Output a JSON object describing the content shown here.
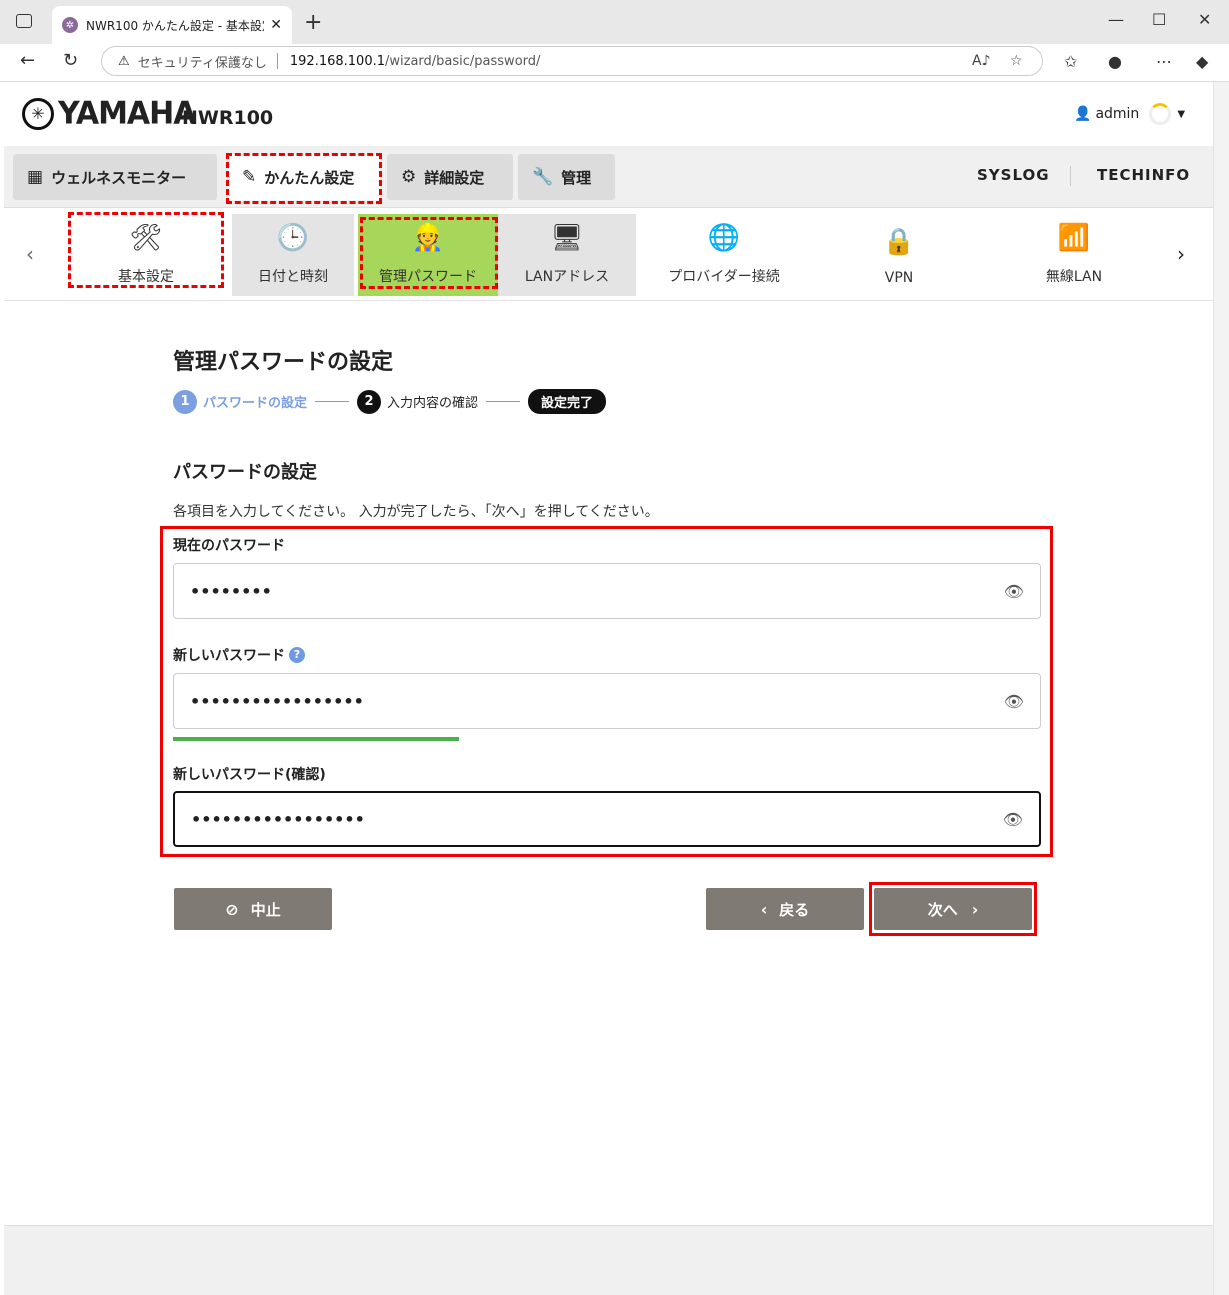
{
  "browser": {
    "tab_title": "NWR100 かんたん設定 - 基本設定 -",
    "security_label": "セキュリティ保護なし",
    "url_host": "192.168.100.1",
    "url_path": "/wizard/basic/password/"
  },
  "header": {
    "brand": "YAMAHA",
    "model": "NWR100",
    "user": "admin"
  },
  "menu": {
    "wellness": "ウェルネスモニター",
    "easy": "かんたん設定",
    "advanced": "詳細設定",
    "admin": "管理",
    "syslog": "SYSLOG",
    "techinfo": "TECHINFO"
  },
  "subnav": {
    "items": [
      "基本設定",
      "日付と時刻",
      "管理パスワード",
      "LANアドレス",
      "プロバイダー接続",
      "VPN",
      "無線LAN"
    ]
  },
  "page": {
    "title": "管理パスワードの設定",
    "steps": {
      "step1_num": "1",
      "step1": "パスワードの設定",
      "step2_num": "2",
      "step2": "入力内容の確認",
      "step3": "設定完了"
    },
    "section_title": "パスワードの設定",
    "description": "各項目を入力してください。 入力が完了したら、「次へ」を押してください。",
    "fields": {
      "current_label": "現在のパスワード",
      "current_value": "••••••••",
      "new_label": "新しいパスワード",
      "new_value": "•••••••••••••••••",
      "confirm_label": "新しいパスワード(確認)",
      "confirm_value": "•••••••••••••••••",
      "new_strength": 0.33
    },
    "buttons": {
      "cancel": "中止",
      "back": "戻る",
      "next": "次へ"
    }
  }
}
